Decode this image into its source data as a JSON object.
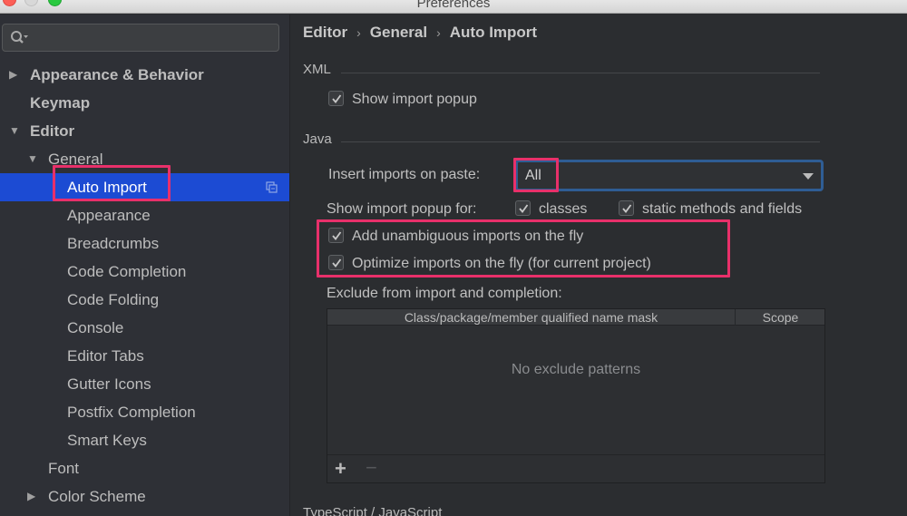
{
  "window": {
    "title": "Preferences"
  },
  "sidebar": {
    "search_placeholder": "",
    "items": [
      {
        "label": "Appearance & Behavior",
        "level": 0,
        "arrow": "collapsed",
        "bold": true
      },
      {
        "label": "Keymap",
        "level": 0,
        "arrow": "none",
        "bold": true
      },
      {
        "label": "Editor",
        "level": 0,
        "arrow": "expanded",
        "bold": true
      },
      {
        "label": "General",
        "level": 1,
        "arrow": "expanded",
        "bold": false
      },
      {
        "label": "Auto Import",
        "level": 2,
        "arrow": "none",
        "bold": false,
        "selected": true
      },
      {
        "label": "Appearance",
        "level": 2,
        "arrow": "none",
        "bold": false
      },
      {
        "label": "Breadcrumbs",
        "level": 2,
        "arrow": "none",
        "bold": false
      },
      {
        "label": "Code Completion",
        "level": 2,
        "arrow": "none",
        "bold": false
      },
      {
        "label": "Code Folding",
        "level": 2,
        "arrow": "none",
        "bold": false
      },
      {
        "label": "Console",
        "level": 2,
        "arrow": "none",
        "bold": false
      },
      {
        "label": "Editor Tabs",
        "level": 2,
        "arrow": "none",
        "bold": false
      },
      {
        "label": "Gutter Icons",
        "level": 2,
        "arrow": "none",
        "bold": false
      },
      {
        "label": "Postfix Completion",
        "level": 2,
        "arrow": "none",
        "bold": false
      },
      {
        "label": "Smart Keys",
        "level": 2,
        "arrow": "none",
        "bold": false
      },
      {
        "label": "Font",
        "level": 1,
        "arrow": "none",
        "bold": false
      },
      {
        "label": "Color Scheme",
        "level": 1,
        "arrow": "collapsed",
        "bold": false
      }
    ]
  },
  "breadcrumb": [
    "Editor",
    "General",
    "Auto Import"
  ],
  "xml": {
    "title": "XML",
    "show_import_popup": {
      "label": "Show import popup",
      "checked": true
    }
  },
  "java": {
    "title": "Java",
    "insert_imports_label": "Insert imports on paste:",
    "insert_imports_value": "All",
    "show_popup_for_label": "Show import popup for:",
    "popup_classes": {
      "label": "classes",
      "checked": true
    },
    "popup_static": {
      "label": "static methods and fields",
      "checked": true
    },
    "add_unambiguous": {
      "label": "Add unambiguous imports on the fly",
      "checked": true
    },
    "optimize_imports": {
      "label": "Optimize imports on the fly (for current project)",
      "checked": true
    },
    "exclude_label": "Exclude from import and completion:",
    "table": {
      "columns": [
        "Class/package/member qualified name mask",
        "Scope"
      ],
      "empty_text": "No exclude patterns",
      "add_label": "+",
      "remove_label": "−"
    }
  },
  "typescript": {
    "title": "TypeScript / JavaScript"
  },
  "colors": {
    "selection": "#1c4bd3",
    "highlight": "#e8306a",
    "focus_border": "#2f5d94"
  }
}
